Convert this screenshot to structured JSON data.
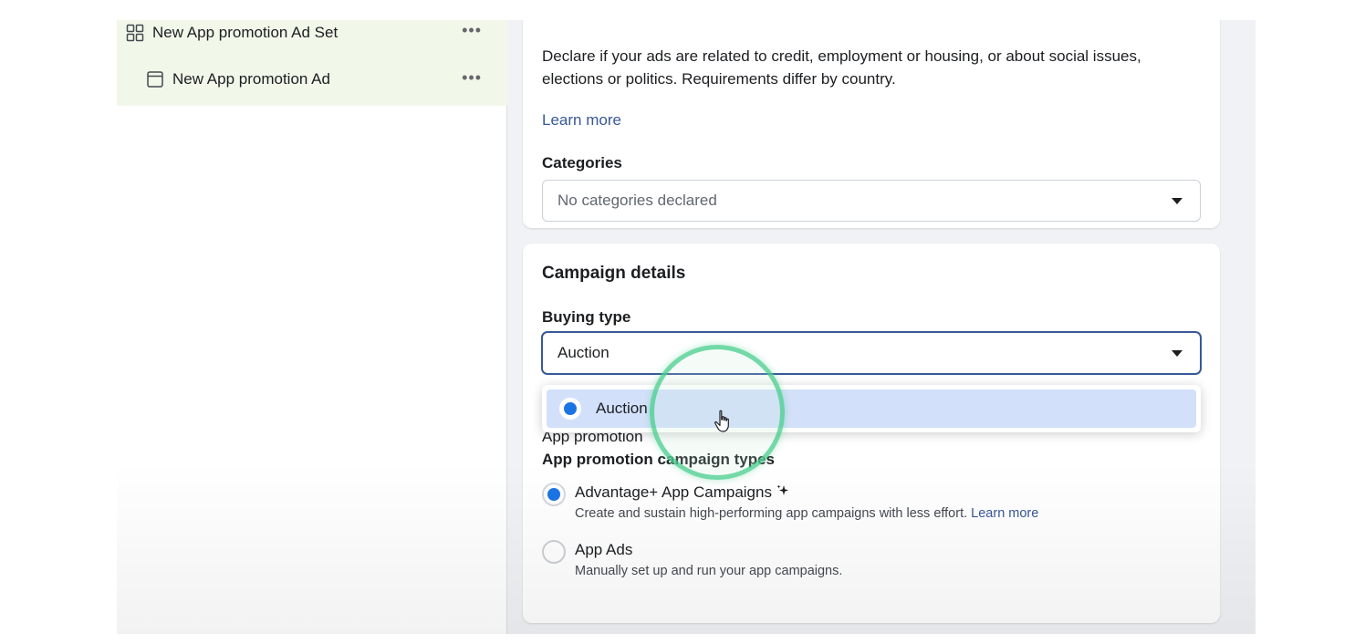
{
  "tree": {
    "adset_label": "New App promotion Ad Set",
    "ad_label": "New App promotion Ad",
    "more_glyph": "•••"
  },
  "special_categories": {
    "description": "Declare if your ads are related to credit, employment or housing, or about social issues, elections or politics. Requirements differ by country.",
    "learn_more": "Learn more",
    "categories_label": "Categories",
    "categories_value": "No categories declared"
  },
  "campaign_details": {
    "title": "Campaign details",
    "buying_type_label": "Buying type",
    "buying_type_value": "Auction",
    "dropdown_options": [
      {
        "label": "Auction",
        "selected": true
      }
    ],
    "app_promotion_partial": "App promotion",
    "campaign_types_label": "App promotion campaign types",
    "options": [
      {
        "title": "Advantage+ App Campaigns",
        "desc": "Create and sustain high-performing app campaigns with less effort.",
        "link": "Learn more",
        "selected": true
      },
      {
        "title": "App Ads",
        "desc": "Manually set up and run your app campaigns.",
        "selected": false
      }
    ]
  },
  "colors": {
    "accent": "#1b74e4",
    "link": "#385898",
    "selection_bg": "#d3e0fa",
    "tree_bg": "#f1f8ea",
    "cursor_ring": "#46cd8c"
  },
  "icons": {
    "adset": "grid-icon",
    "ad": "window-icon",
    "sparkle": "sparkle-icon",
    "cursor": "hand-cursor-icon"
  }
}
